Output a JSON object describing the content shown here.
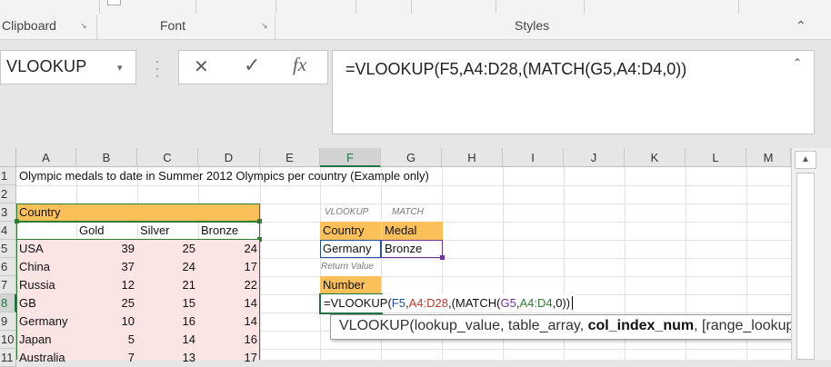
{
  "ribbon": {
    "groups": [
      {
        "label": "Clipboard"
      },
      {
        "label": "Font"
      },
      {
        "label": "Styles"
      }
    ],
    "collapse_glyph": "⌃"
  },
  "name_box": {
    "value": "VLOOKUP",
    "dropdown_icon": "chevron-down-icon"
  },
  "formula_bar": {
    "cancel_glyph": "✕",
    "enter_glyph": "✓",
    "fx_glyph": "fx",
    "formula": "=VLOOKUP(F5,A4:D28,(MATCH(G5,A4:D4,0))"
  },
  "columns": [
    "A",
    "B",
    "C",
    "D",
    "E",
    "F",
    "G",
    "H",
    "I",
    "J",
    "K",
    "L",
    "M"
  ],
  "rows": [
    "1",
    "2",
    "3",
    "4",
    "5",
    "6",
    "7",
    "8",
    "9",
    "10",
    "11"
  ],
  "sheet": {
    "title": "Olympic medals to date in Summer 2012 Olympics per country (Example only)",
    "country_header": "Country",
    "medal_headers": [
      "Gold",
      "Silver",
      "Bronze"
    ],
    "table": [
      {
        "country": "USA",
        "gold": "39",
        "silver": "25",
        "bronze": "24"
      },
      {
        "country": "China",
        "gold": "37",
        "silver": "24",
        "bronze": "17"
      },
      {
        "country": "Russia",
        "gold": "12",
        "silver": "21",
        "bronze": "22"
      },
      {
        "country": "GB",
        "gold": "25",
        "silver": "15",
        "bronze": "14"
      },
      {
        "country": "Germany",
        "gold": "10",
        "silver": "16",
        "bronze": "14"
      },
      {
        "country": "Japan",
        "gold": "5",
        "silver": "14",
        "bronze": "16"
      },
      {
        "country": "Australia",
        "gold": "7",
        "silver": "13",
        "bronze": "17"
      }
    ],
    "lookup_label_vlookup": "VLOOKUP",
    "lookup_label_match": "MATCH",
    "input_header_country": "Country",
    "input_header_medal": "Medal",
    "input_country": "Germany",
    "input_medal": "Bronze",
    "return_value_label": "Return Value",
    "number_header": "Number",
    "edit_prefix": "=VLOOKUP(",
    "edit_ref1": "F5",
    "edit_sep1": ",",
    "edit_ref2": "A4:D28",
    "edit_mid": ",(MATCH(",
    "edit_ref3": "G5",
    "edit_sep2": ",",
    "edit_ref4": "A4:D4",
    "edit_suffix": ",0))"
  },
  "tooltip": {
    "func": "VLOOKUP(",
    "arg1": "lookup_value",
    "sep1": ", ",
    "arg2": "table_array",
    "sep2": ", ",
    "arg3_bold": "col_index_num",
    "sep3": ", ",
    "arg4": "[range_lookup])"
  },
  "colors": {
    "accent_green": "#217346",
    "ref_blue": "#1f4ea3",
    "ref_red": "#c0392b",
    "ref_purple": "#7030a0",
    "ref_green": "#2e7d32",
    "header_orange": "#fcc05a",
    "table_pink": "#fbe4e4"
  }
}
